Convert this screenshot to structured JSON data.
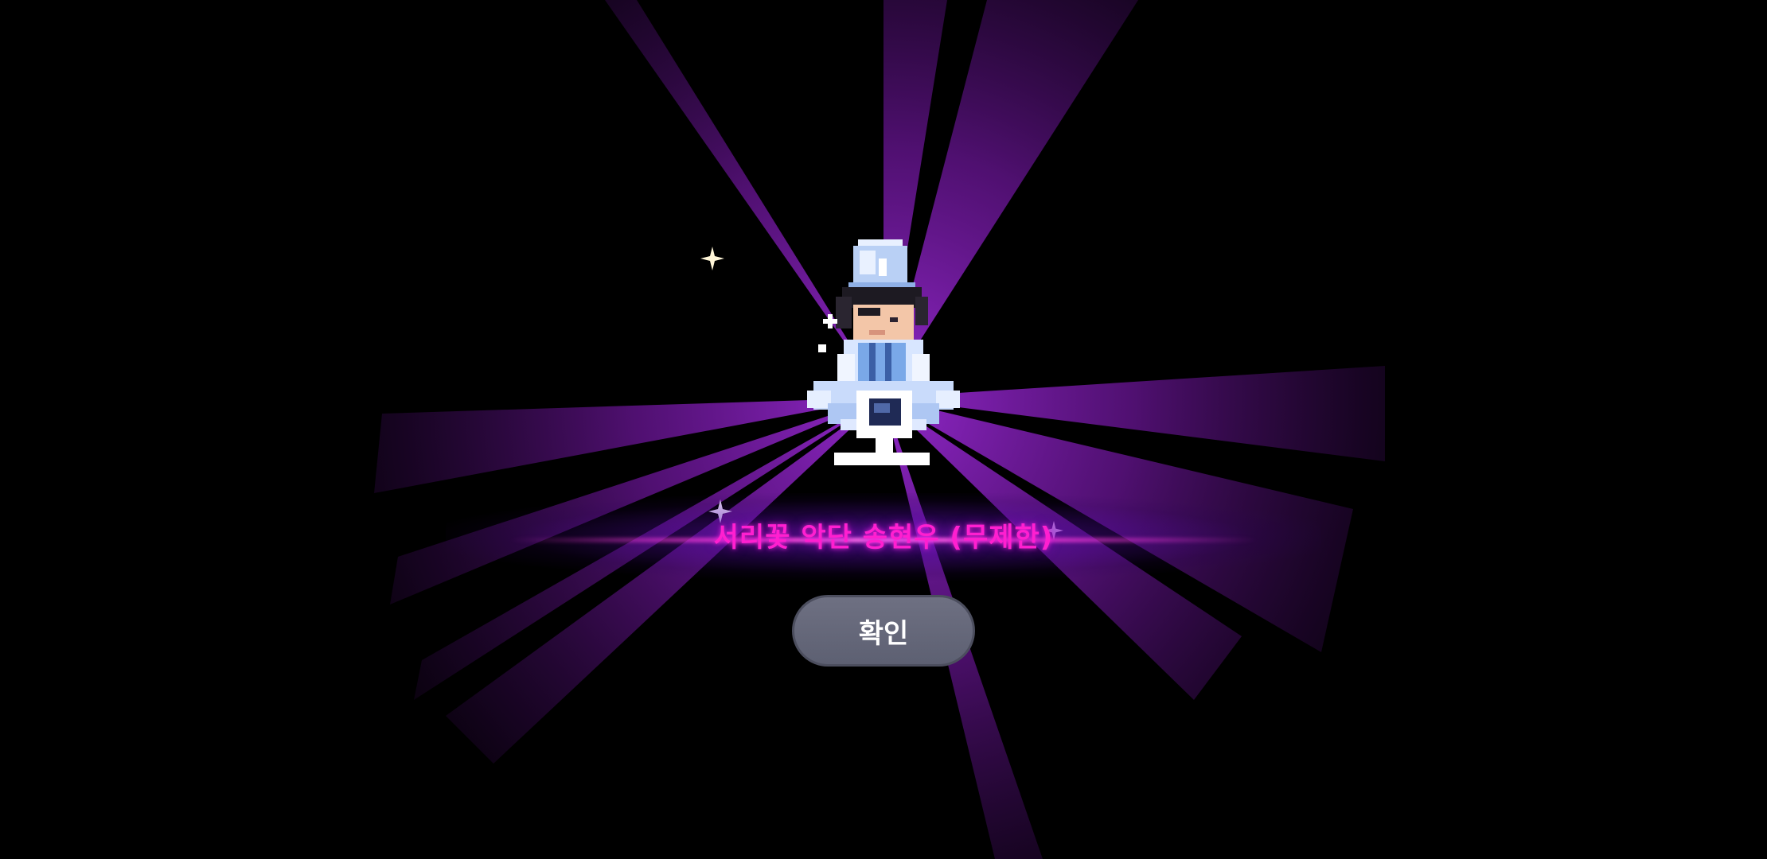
{
  "reward": {
    "item_title": "서리꽃 악단 송현우 (무제한)"
  },
  "dialog": {
    "confirm_label": "확인"
  },
  "icons": {
    "character": "character-costume-icon",
    "sparkle": "sparkle-icon"
  },
  "colors": {
    "background": "#000000",
    "ray": "#7a1aa8",
    "title": "#ff1fd0",
    "button": "#6e7082"
  }
}
